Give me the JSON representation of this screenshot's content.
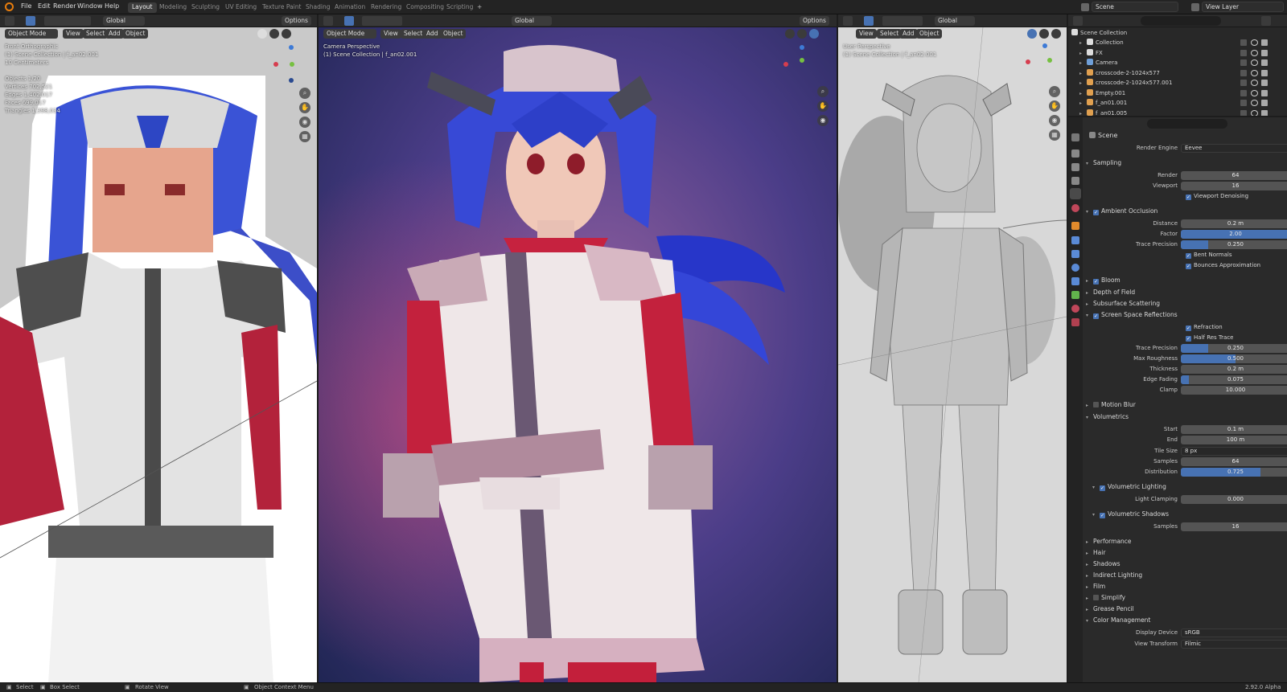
{
  "menu": [
    "File",
    "Edit",
    "Render",
    "Window",
    "Help"
  ],
  "workspaces": [
    "Layout",
    "Modeling",
    "Sculpting",
    "UV Editing",
    "Texture Paint",
    "Shading",
    "Animation",
    "Rendering",
    "Compositing",
    "Scripting"
  ],
  "add_tab": "+",
  "top_right": {
    "scene": "Scene",
    "view_layer": "View Layer"
  },
  "viewport_header": {
    "mode": "Object Mode",
    "view": "View",
    "select": "Select",
    "add": "Add",
    "object": "Object",
    "orientation": "Global",
    "options": "Options"
  },
  "left_viewport": {
    "view_name": "Front Orthographic",
    "collection": "(1) Scene Collection | f_an02.001",
    "units": "10 Centimeters",
    "stats": [
      "Objects 1/20",
      "Vertices 702,521",
      "Edges 1,402,017",
      "Faces 699,017",
      "Triangles 1,398,034"
    ]
  },
  "center_viewport": {
    "view_name": "Camera Perspective",
    "collection": "(1) Scene Collection | f_an02.001"
  },
  "right_viewport": {
    "view_name": "User Perspective",
    "collection": "(1) Scene Collection | f_an02.001"
  },
  "outliner": {
    "root": "Scene Collection",
    "items": [
      {
        "label": "Collection",
        "color": "#dddddd"
      },
      {
        "label": "FX",
        "color": "#dddddd"
      },
      {
        "label": "Camera",
        "color": "#6f9fd8"
      },
      {
        "label": "crosscode-2-1024x577",
        "color": "#e0a050"
      },
      {
        "label": "crosscode-2-1024x577.001",
        "color": "#e0a050"
      },
      {
        "label": "Empty.001",
        "color": "#e0a050"
      },
      {
        "label": "f_an01.001",
        "color": "#e0a050"
      },
      {
        "label": "f_an01.005",
        "color": "#e0a050"
      }
    ]
  },
  "properties": {
    "context": "Scene",
    "render_engine_label": "Render Engine",
    "render_engine": "Eevee",
    "sampling": {
      "title": "Sampling",
      "render_label": "Render",
      "render": "64",
      "viewport_label": "Viewport",
      "viewport": "16",
      "denoise": "Viewport Denoising"
    },
    "ao": {
      "title": "Ambient Occlusion",
      "distance_label": "Distance",
      "distance": "0.2 m",
      "factor_label": "Factor",
      "factor": "2.00",
      "factor_fill": 1.0,
      "trace_label": "Trace Precision",
      "trace": "0.250",
      "trace_fill": 0.25,
      "bent": "Bent Normals",
      "bounces": "Bounces Approximation"
    },
    "bloom": "Bloom",
    "dof": "Depth of Field",
    "sss": "Subsurface Scattering",
    "ssr": {
      "title": "Screen Space Reflections",
      "refraction": "Refraction",
      "half_res": "Half Res Trace",
      "trace_label": "Trace Precision",
      "trace": "0.250",
      "trace_fill": 0.25,
      "rough_label": "Max Roughness",
      "rough": "0.500",
      "rough_fill": 0.5,
      "thick_label": "Thickness",
      "thick": "0.2 m",
      "edge_label": "Edge Fading",
      "edge": "0.075",
      "edge_fill": 0.075,
      "clamp_label": "Clamp",
      "clamp": "10.000"
    },
    "motion_blur": "Motion Blur",
    "vol": {
      "title": "Volumetrics",
      "start_label": "Start",
      "start": "0.1 m",
      "end_label": "End",
      "end": "100 m",
      "tile_label": "Tile Size",
      "tile": "8 px",
      "samples_label": "Samples",
      "samples": "64",
      "dist_label": "Distribution",
      "dist": "0.725",
      "dist_fill": 0.725,
      "lighting": "Volumetric Lighting",
      "clamp_label": "Light Clamping",
      "clamp": "0.000",
      "shadows": "Volumetric Shadows",
      "shadow_samples_label": "Samples",
      "shadow_samples": "16"
    },
    "collapsed": [
      "Performance",
      "Hair",
      "Shadows",
      "Indirect Lighting",
      "Film"
    ],
    "simplify": "Simplify",
    "grease": "Grease Pencil",
    "color": {
      "title": "Color Management",
      "device_label": "Display Device",
      "device": "sRGB",
      "transform_label": "View Transform",
      "transform": "Filmic"
    }
  },
  "status": {
    "select": "Select",
    "box": "Box Select",
    "rotate": "Rotate View",
    "context": "Object Context Menu",
    "version": "2.92.0 Alpha"
  }
}
